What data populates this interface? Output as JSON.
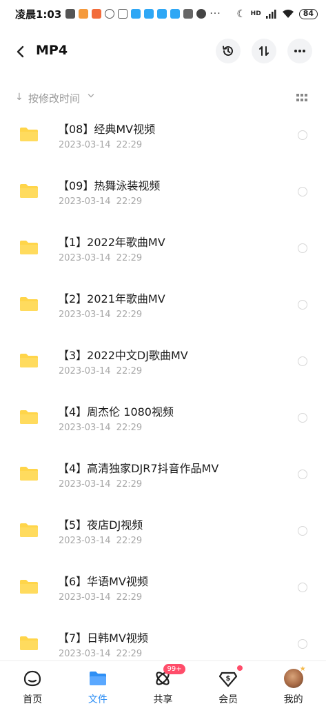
{
  "status_bar": {
    "time": "凌晨1:03",
    "network": "HD",
    "battery": "84"
  },
  "header": {
    "title": "MP4"
  },
  "sort": {
    "label": "按修改时间"
  },
  "files": [
    {
      "name": "【08】经典MV视频",
      "date": "2023-03-14  22:29"
    },
    {
      "name": "【09】热舞泳装视频",
      "date": "2023-03-14  22:29"
    },
    {
      "name": "【1】2022年歌曲MV",
      "date": "2023-03-14  22:29"
    },
    {
      "name": "【2】2021年歌曲MV",
      "date": "2023-03-14  22:29"
    },
    {
      "name": "【3】2022中文DJ歌曲MV",
      "date": "2023-03-14  22:29"
    },
    {
      "name": "【4】周杰伦 1080视频",
      "date": "2023-03-14  22:29"
    },
    {
      "name": "【4】高清独家DJR7抖音作品MV",
      "date": "2023-03-14  22:29"
    },
    {
      "name": "【5】夜店DJ视频",
      "date": "2023-03-14  22:29"
    },
    {
      "name": "【6】华语MV视频",
      "date": "2023-03-14  22:29"
    },
    {
      "name": "【7】日韩MV视频",
      "date": "2023-03-14  22:29"
    }
  ],
  "nav": {
    "home": "首页",
    "files": "文件",
    "share": "共享",
    "share_badge": "99+",
    "vip": "会员",
    "mine": "我的"
  },
  "colors": {
    "accent": "#2e8ff5",
    "folder": "#ffd54a",
    "badge": "#ff4d6a"
  }
}
